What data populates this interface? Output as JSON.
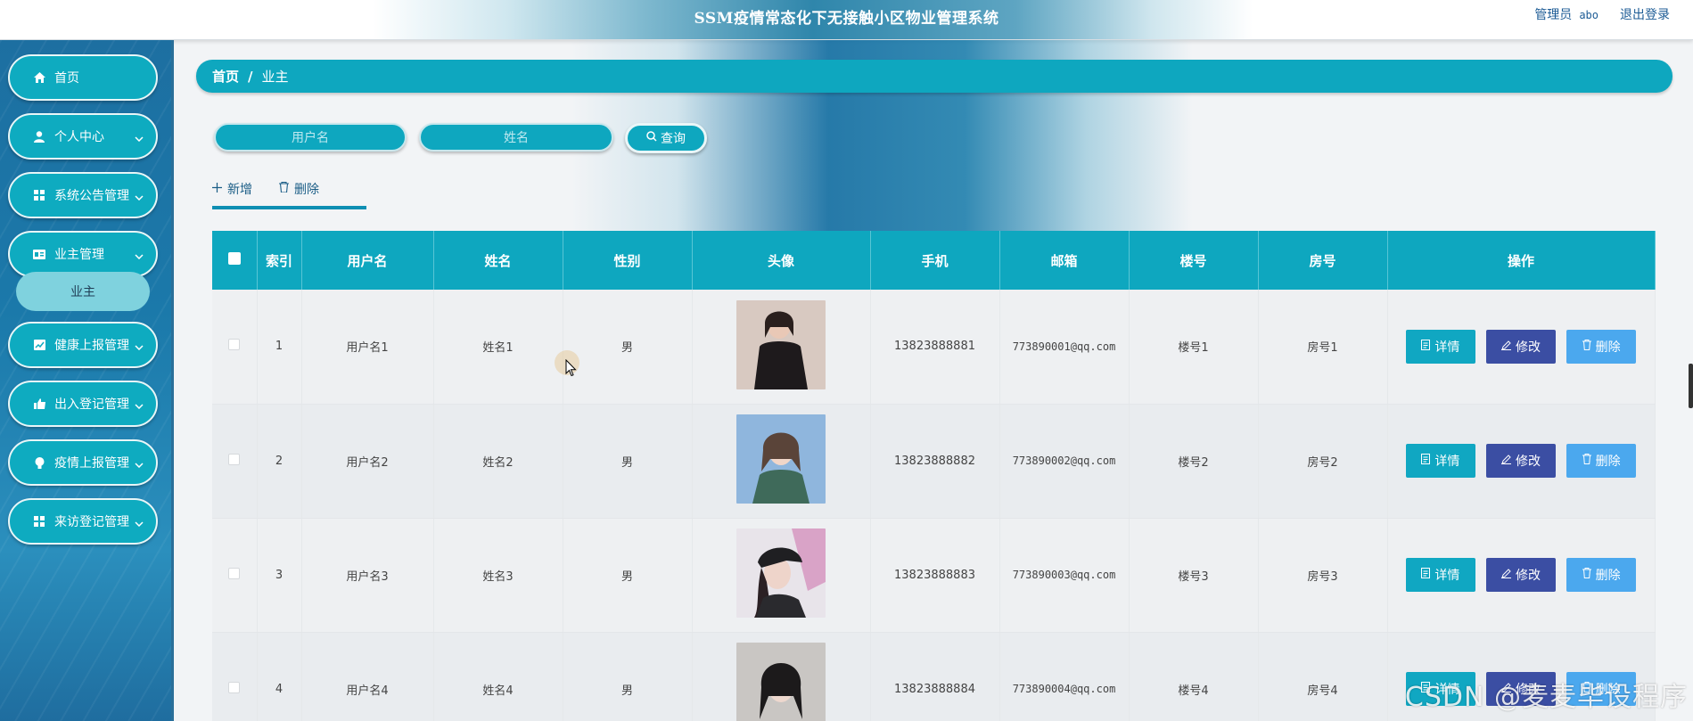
{
  "header": {
    "title": "SSM疫情常态化下无接触小区物业管理系统",
    "admin_label": "管理员",
    "admin_name": "abo",
    "logout": "退出登录"
  },
  "sidebar": {
    "items": [
      {
        "label": "首页",
        "icon": "home-icon"
      },
      {
        "label": "个人中心",
        "icon": "user-icon"
      },
      {
        "label": "系统公告管理",
        "icon": "grid-icon"
      },
      {
        "label": "业主管理",
        "icon": "id-card-icon"
      },
      {
        "label": "健康上报管理",
        "icon": "chart-icon"
      },
      {
        "label": "出入登记管理",
        "icon": "thumb-icon"
      },
      {
        "label": "疫情上报管理",
        "icon": "bulb-icon"
      },
      {
        "label": "来访登记管理",
        "icon": "grid-icon"
      }
    ],
    "submenu": {
      "label": "业主"
    }
  },
  "breadcrumb": {
    "home": "首页",
    "sep": "/",
    "current": "业主"
  },
  "search": {
    "username_placeholder": "用户名",
    "name_placeholder": "姓名",
    "query_label": "查询"
  },
  "actions": {
    "add_label": "新增",
    "delete_label": "删除"
  },
  "table": {
    "columns": [
      "索引",
      "用户名",
      "姓名",
      "性别",
      "头像",
      "手机",
      "邮箱",
      "楼号",
      "房号",
      "操作"
    ],
    "rows": [
      {
        "index": "1",
        "username": "用户名1",
        "name": "姓名1",
        "gender": "男",
        "phone": "13823888881",
        "email": "773890001@qq.com",
        "building": "楼号1",
        "room": "房号1"
      },
      {
        "index": "2",
        "username": "用户名2",
        "name": "姓名2",
        "gender": "男",
        "phone": "13823888882",
        "email": "773890002@qq.com",
        "building": "楼号2",
        "room": "房号2"
      },
      {
        "index": "3",
        "username": "用户名3",
        "name": "姓名3",
        "gender": "男",
        "phone": "13823888883",
        "email": "773890003@qq.com",
        "building": "楼号3",
        "room": "房号3"
      },
      {
        "index": "4",
        "username": "用户名4",
        "name": "姓名4",
        "gender": "男",
        "phone": "13823888884",
        "email": "773890004@qq.com",
        "building": "楼号4",
        "room": "房号4"
      }
    ],
    "buttons": {
      "detail": "详情",
      "edit": "修改",
      "delete": "删除"
    }
  },
  "watermark": "CSDN @麦麦毕设程序",
  "colors": {
    "primary": "#0ea7bf",
    "edit": "#3b4ea3",
    "delete": "#4ba8ee",
    "sidebar": "#1b79aa"
  }
}
